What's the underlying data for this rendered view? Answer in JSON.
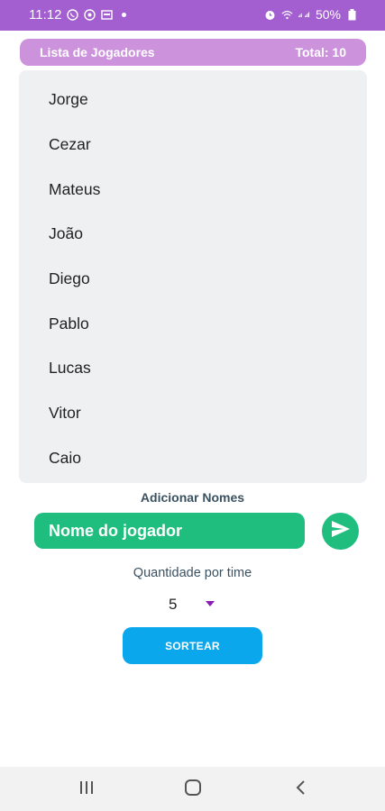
{
  "status_bar": {
    "time": "11:12",
    "battery": "50%",
    "icons": [
      "whatsapp-icon",
      "media-icon",
      "gallery-icon",
      "alarm-icon",
      "wifi-icon",
      "signal-icon",
      "battery-icon"
    ]
  },
  "header": {
    "title": "Lista de Jogadores",
    "total": "Total: 10"
  },
  "players": [
    "Jorge",
    "Cezar",
    "Mateus",
    "João",
    "Diego",
    "Pablo",
    "Lucas",
    "Vitor",
    "Caio"
  ],
  "add": {
    "label": "Adicionar Nomes",
    "placeholder": "Nome do jogador",
    "value": ""
  },
  "quantity": {
    "label": "Quantidade por time",
    "selected": "5"
  },
  "sort_button": "SORTEAR",
  "colors": {
    "status_bar": "#a35ed0",
    "header": "#cc93dc",
    "input": "#1fbe7f",
    "button": "#0aa7ec",
    "list_bg": "#eff0f2",
    "caret": "#8a1bb5"
  }
}
